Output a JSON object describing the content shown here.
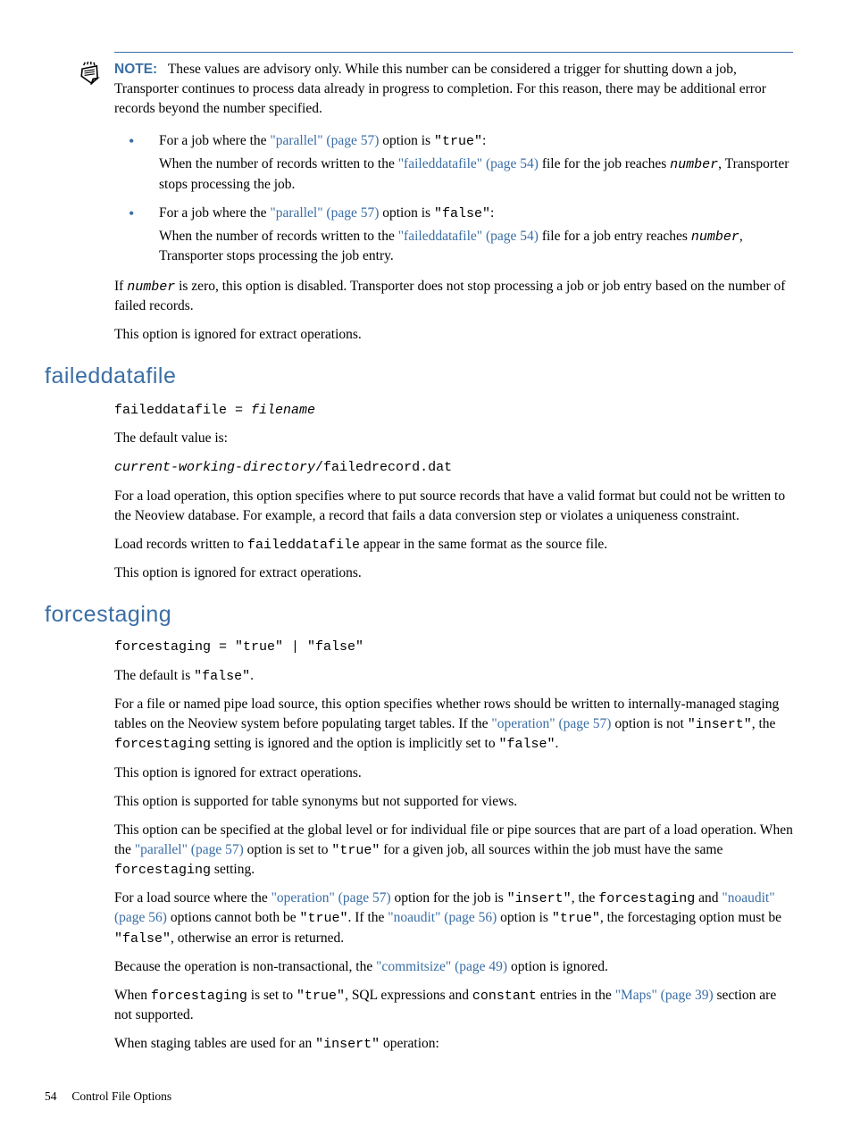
{
  "note": {
    "label": "NOTE:",
    "body_pre": "These values are advisory only. While this number can be considered a trigger for shutting down a job, Transporter continues to process data already in progress to completion. For this reason, there may be additional error records beyond the number specified."
  },
  "bullets": [
    {
      "lead_a": "For a job where the ",
      "link1": "\"parallel\" (page 57)",
      "lead_b": " option is ",
      "code1": "\"true\"",
      "lead_c": ":",
      "sub_a": "When the number of records written to the ",
      "sub_link": "\"faileddatafile\" (page 54)",
      "sub_b": " file for the job reaches ",
      "sub_code": "number",
      "sub_c": ", Transporter stops processing the job."
    },
    {
      "lead_a": "For a job where the ",
      "link1": "\"parallel\" (page 57)",
      "lead_b": " option is ",
      "code1": "\"false\"",
      "lead_c": ":",
      "sub_a": "When the number of records written to the ",
      "sub_link": "\"faileddatafile\" (page 54)",
      "sub_b": " file for a job entry reaches ",
      "sub_code": "number",
      "sub_c": ", Transporter stops processing the job entry."
    }
  ],
  "after_bullets": {
    "p1_a": "If ",
    "p1_code": "number",
    "p1_b": " is zero, this option is disabled. Transporter does not stop processing a job or job entry based on the number of failed records.",
    "p2": "This option is ignored for extract operations."
  },
  "sec_faileddatafile": {
    "heading": "faileddatafile",
    "syntax_a": "faileddatafile = ",
    "syntax_b": "filename",
    "p1": "The default value is:",
    "default_a": "current-working-directory",
    "default_b": "/failedrecord.dat",
    "p2": "For a load operation, this option specifies where to put source records that have a valid format but could not be written to the Neoview database. For example, a record that fails a data conversion step or violates a uniqueness constraint.",
    "p3_a": "Load records written to ",
    "p3_code": "faileddatafile",
    "p3_b": " appear in the same format as the source file.",
    "p4": "This option is ignored for extract operations."
  },
  "sec_forcestaging": {
    "heading": "forcestaging",
    "syntax": "forcestaging = \"true\" | \"false\"",
    "p1_a": "The default is ",
    "p1_code": "\"false\"",
    "p1_b": ".",
    "p2_a": "For a file or named pipe load source, this option specifies whether rows should be written to internally-managed staging tables on the Neoview system before populating target tables. If the ",
    "p2_link": "\"operation\" (page 57)",
    "p2_b": " option is not ",
    "p2_code1": "\"insert\"",
    "p2_c": ", the ",
    "p2_code2": "forcestaging",
    "p2_d": " setting is ignored and the option is implicitly set to ",
    "p2_code3": "\"false\"",
    "p2_e": ".",
    "p3": "This option is ignored for extract operations.",
    "p4": "This option is supported for table synonyms but not supported for views.",
    "p5_a": "This option can be specified at the global level or for individual file or pipe sources that are part of a load operation. When the ",
    "p5_link": "\"parallel\" (page 57)",
    "p5_b": " option is set to ",
    "p5_code1": "\"true\"",
    "p5_c": " for a given job, all sources within the job must have the same ",
    "p5_code2": "forcestaging",
    "p5_d": " setting.",
    "p6_a": "For a load source where the ",
    "p6_link1": "\"operation\" (page 57)",
    "p6_b": " option for the job is ",
    "p6_code1": "\"insert\"",
    "p6_c": ", the ",
    "p6_code2": "forcestaging",
    "p6_d": " and ",
    "p6_link2": "\"noaudit\" (page 56)",
    "p6_e": " options cannot both be ",
    "p6_code3": "\"true\"",
    "p6_f": ". If the ",
    "p6_link3": "\"noaudit\" (page 56)",
    "p6_g": " option is ",
    "p6_code4": "\"true\"",
    "p6_h": ", the forcestaging option must be ",
    "p6_code5": "\"false\"",
    "p6_i": ", otherwise an error is returned.",
    "p7_a": "Because the operation is non-transactional, the ",
    "p7_link": "\"commitsize\" (page 49)",
    "p7_b": " option is ignored.",
    "p8_a": "When ",
    "p8_code1": "forcestaging",
    "p8_b": " is set to ",
    "p8_code2": "\"true\"",
    "p8_c": ", SQL expressions and ",
    "p8_code3": "constant",
    "p8_d": " entries in the ",
    "p8_link": "\"Maps\" (page 39)",
    "p8_e": " section are not supported.",
    "p9_a": "When staging tables are used for an ",
    "p9_code": "\"insert\"",
    "p9_b": " operation:"
  },
  "footer": {
    "page": "54",
    "title": "Control File Options"
  }
}
